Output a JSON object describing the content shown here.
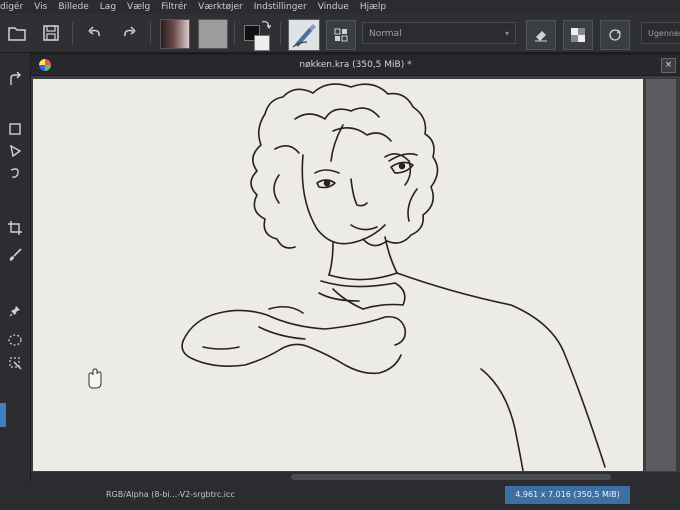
{
  "menubar": {
    "items": [
      "digér",
      "Vis",
      "Billede",
      "Lag",
      "Vælg",
      "Filtrér",
      "Værktøjer",
      "Indstillinger",
      "Vindue",
      "Hjælp"
    ]
  },
  "toolbar": {
    "blend_mode": "Normal",
    "opacity_label": "Ugennem"
  },
  "document": {
    "title": "nøkken.kra (350,5 MiB) *",
    "close_glyph": "×"
  },
  "status": {
    "color_profile": "RGB/Alpha (8-bi...-V2-srgbtrc.icc",
    "image_size": "4.961 x 7.016 (350,5 MiB)"
  },
  "icons": {
    "file": "folder-icon",
    "save": "save-icon",
    "undo": "undo-icon",
    "redo": "redo-icon",
    "eraser": "eraser-icon",
    "alpha": "checker-icon",
    "wrap": "wrap-icon",
    "cursor": "hand-cursor-icon"
  },
  "colors": {
    "accent": "#3d6fa3",
    "canvas": "#ecebe6",
    "line_art": "#2a211d"
  }
}
